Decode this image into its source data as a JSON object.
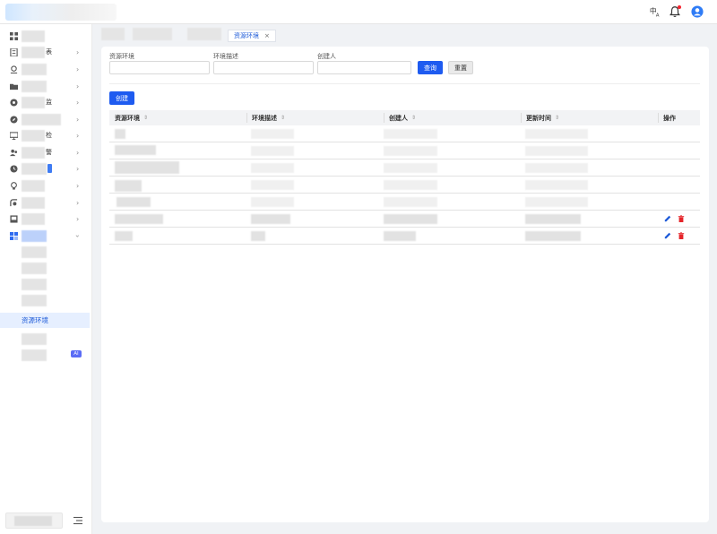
{
  "header": {
    "translate_icon": "translate-icon",
    "bell_icon": "bell-icon",
    "avatar_icon": "user-avatar-icon"
  },
  "sidebar": {
    "items": [
      {
        "icon": "dashboard-icon",
        "label_suffix": ""
      },
      {
        "icon": "report-icon",
        "label_suffix": "表"
      },
      {
        "icon": "monitor-icon",
        "label_suffix": ""
      },
      {
        "icon": "folder-icon",
        "label_suffix": ""
      },
      {
        "icon": "circle-gear-icon",
        "label_suffix": "监"
      },
      {
        "icon": "compass-icon",
        "label_suffix": ""
      },
      {
        "icon": "screen-icon",
        "label_suffix": "检"
      },
      {
        "icon": "people-icon",
        "label_suffix": "警"
      },
      {
        "icon": "clock-icon",
        "label_suffix": ""
      },
      {
        "icon": "bulb-icon",
        "label_suffix": ""
      },
      {
        "icon": "flow-icon",
        "label_suffix": ""
      },
      {
        "icon": "book-icon",
        "label_suffix": ""
      },
      {
        "icon": "cubes-icon",
        "label_suffix": ""
      }
    ],
    "active_sub_label": "资源环境",
    "ai_badge": "AI"
  },
  "tabs": {
    "active_label": "资源环境",
    "close_glyph": "×"
  },
  "filters": {
    "env_label": "资源环境",
    "desc_label": "环境描述",
    "creator_label": "创建人",
    "search_button": "查询",
    "reset_button": "重置"
  },
  "toolbar": {
    "create_button": "创建"
  },
  "table": {
    "columns": [
      "资源环境",
      "环境描述",
      "创建人",
      "更新时间",
      "操作"
    ],
    "sort_glyph": "⇕"
  },
  "colors": {
    "primary": "#1e5bf0",
    "danger": "#e5252a",
    "active_bg": "#e6efff"
  }
}
